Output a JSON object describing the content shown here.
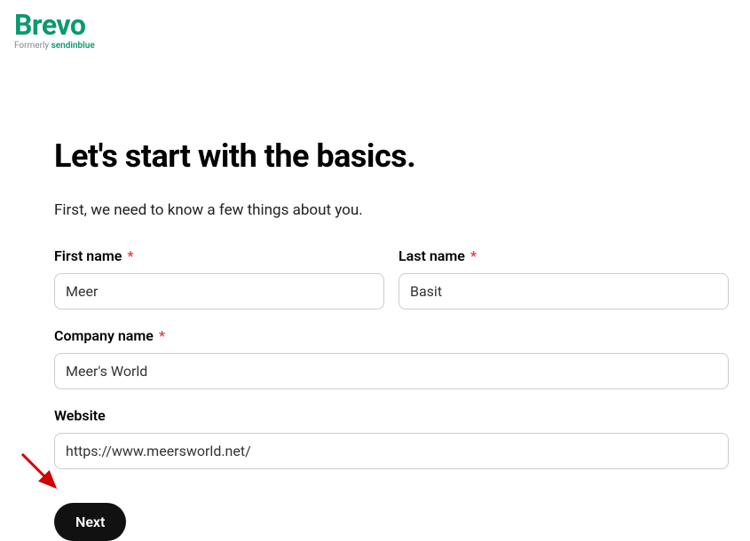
{
  "logo": {
    "brand": "Brevo",
    "tagline_prefix": "Formerly ",
    "tagline_brand": "sendinblue"
  },
  "heading": "Let's start with the basics.",
  "subtitle": "First, we need to know a few things about you.",
  "form": {
    "first_name": {
      "label": "First name",
      "value": "Meer",
      "required": true
    },
    "last_name": {
      "label": "Last name",
      "value": "Basit",
      "required": true
    },
    "company_name": {
      "label": "Company name",
      "value": "Meer's World",
      "required": true
    },
    "website": {
      "label": "Website",
      "value": "https://www.meersworld.net/",
      "required": false
    }
  },
  "buttons": {
    "next": "Next"
  },
  "required_marker": "*"
}
